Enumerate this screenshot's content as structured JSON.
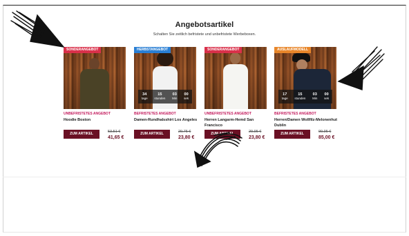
{
  "section": {
    "title": "Angebotsartikel",
    "subtitle": "Schalten Sie zeitlich befristete und unbefristete Werbeboxen."
  },
  "products": [
    {
      "badge": "SONDERANGEBOT",
      "badge_color": "#d9304a",
      "tag": "UNBEFRISTETES ANGEBOT",
      "name": "Hoodie Boston",
      "button": "ZUM ARTIKEL",
      "old_price": "53,51 €",
      "price": "41,65 €",
      "countdown": null
    },
    {
      "badge": "HERBSTANGEBOT",
      "badge_color": "#2a7fd4",
      "tag": "BEFRISTETES ANGEBOT",
      "name": "Damen-Rundhalsshirt Los Angeles",
      "button": "ZUM ARTIKEL",
      "old_price": "29,75 €",
      "price": "23,80 €",
      "countdown": [
        {
          "value": "34",
          "unit": "tage"
        },
        {
          "value": "15",
          "unit": "stunden"
        },
        {
          "value": "03",
          "unit": "Min"
        },
        {
          "value": "00",
          "unit": "sek"
        }
      ]
    },
    {
      "badge": "SONDERANGEBOT",
      "badge_color": "#d9304a",
      "tag": "UNBEFRISTETES ANGEBOT",
      "name": "Herren Langarm-Hemd San Francisco",
      "button": "ZUM ARTIKEL",
      "old_price": "29,95 €",
      "price": "23,80 €",
      "countdown": null
    },
    {
      "badge": "AUSLAUFMODELL",
      "badge_color": "#e8862a",
      "tag": "BEFRISTETES ANGEBOT",
      "name": "Herren/Damen Wollfilz-Melonenhut Dublin",
      "button": "ZUM ARTIKEL",
      "old_price": "99,95 €",
      "price": "85,00 €",
      "countdown": [
        {
          "value": "17",
          "unit": "tage"
        },
        {
          "value": "15",
          "unit": "stunden"
        },
        {
          "value": "03",
          "unit": "Min"
        },
        {
          "value": "00",
          "unit": "sek"
        }
      ]
    }
  ],
  "colors": {
    "accent": "#6a1024",
    "tag": "#c2185b"
  }
}
